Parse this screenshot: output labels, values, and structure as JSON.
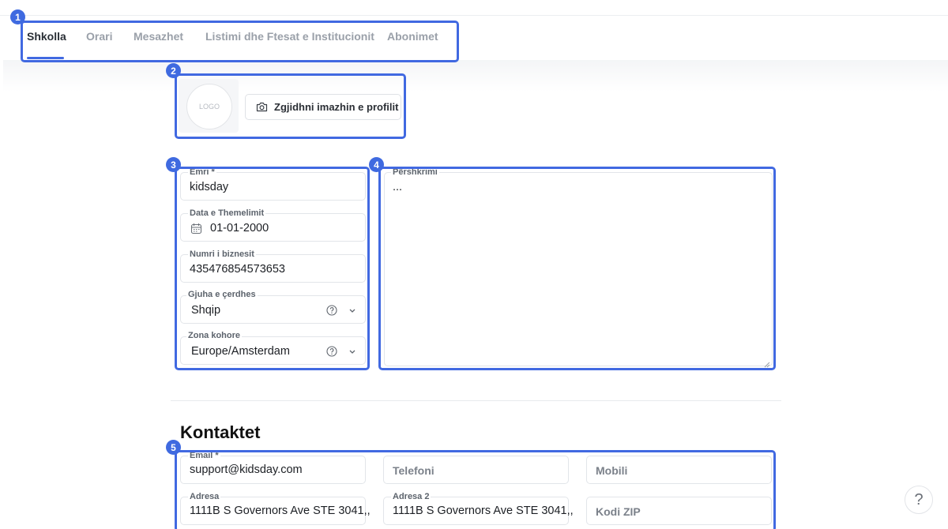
{
  "tabs": [
    {
      "label": "Shkolla",
      "active": true
    },
    {
      "label": "Orari",
      "active": false
    },
    {
      "label": "Mesazhet",
      "active": false
    },
    {
      "label": "Listimi dhe Ftesat e Institucionit",
      "active": false
    },
    {
      "label": "Abonimet",
      "active": false
    }
  ],
  "annotations": [
    "1",
    "2",
    "3",
    "4",
    "5"
  ],
  "profile": {
    "logo_text": "LOGO",
    "upload_label": "Zgjidhni imazhin e profilit",
    "upload_icon": "camera-icon"
  },
  "school": {
    "name": {
      "label": "Emri *",
      "value": "kidsday"
    },
    "founding_date": {
      "label": "Data e Themelimit",
      "value": "01-01-2000",
      "icon": "calendar-icon"
    },
    "business_number": {
      "label": "Numri i biznesit",
      "value": "435476854573653"
    },
    "language": {
      "label": "Gjuha e çerdhes",
      "value": "Shqip",
      "icon": "help-circle-icon"
    },
    "timezone": {
      "label": "Zona kohore",
      "value": "Europe/Amsterdam",
      "icon": "help-circle-icon"
    },
    "description": {
      "label": "Përshkrimi",
      "value": "..."
    }
  },
  "contacts": {
    "title": "Kontaktet",
    "email": {
      "label": "Email *",
      "value": "support@kidsday.com"
    },
    "phone": {
      "placeholder": "Telefoni"
    },
    "mobile": {
      "placeholder": "Mobili"
    },
    "address": {
      "label": "Adresa",
      "value": "1111B S Governors Ave STE 3041,,"
    },
    "address2": {
      "label": "Adresa 2",
      "value": "1111B S Governors Ave STE 3041,,"
    },
    "zip": {
      "placeholder": "Kodi ZIP"
    }
  },
  "help_button": {
    "label": "?"
  },
  "colors": {
    "accent": "#4169e1",
    "badge": "#3f6ae0",
    "border": "#e2e5e9",
    "text": "#1c1f24"
  }
}
